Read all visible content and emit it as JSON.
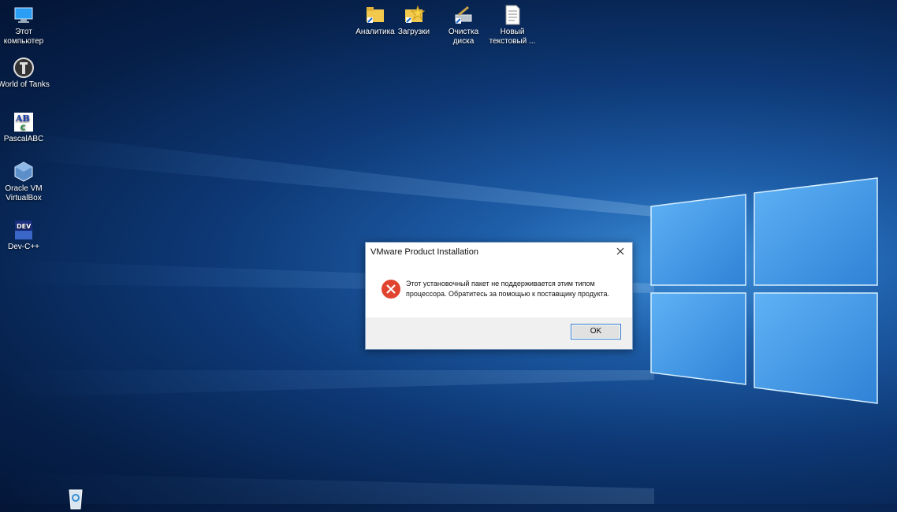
{
  "desktop": {
    "icons": [
      {
        "label": "Этот компьютер",
        "icon": "this-pc-icon"
      },
      {
        "label": "World of Tanks",
        "icon": "world-of-tanks-icon"
      },
      {
        "label": "PascalABC",
        "icon": "pascalabc-icon"
      },
      {
        "label": "Oracle VM VirtualBox",
        "icon": "virtualbox-icon"
      },
      {
        "label": "Dev-C++",
        "icon": "devcpp-icon"
      },
      {
        "label": "Аналитика",
        "icon": "folder-shortcut-icon"
      },
      {
        "label": "Загрузки",
        "icon": "downloads-shortcut-icon"
      },
      {
        "label": "Очистка диска",
        "icon": "disk-cleanup-icon"
      },
      {
        "label": "Новый текстовый ...",
        "icon": "text-document-icon"
      },
      {
        "label": "",
        "icon": "recycle-bin-icon"
      }
    ]
  },
  "dialog": {
    "title": "VMware Product Installation",
    "message": "Этот установочный пакет не поддерживается этим типом процессора. Обратитесь за помощью к поставщику продукта.",
    "ok_label": "OK",
    "icon": "error-icon"
  },
  "colors": {
    "desktop_dark": "#06204a",
    "desktop_light": "#3d8fd9",
    "error_red": "#e0432e",
    "button_border": "#2f7ac9"
  }
}
